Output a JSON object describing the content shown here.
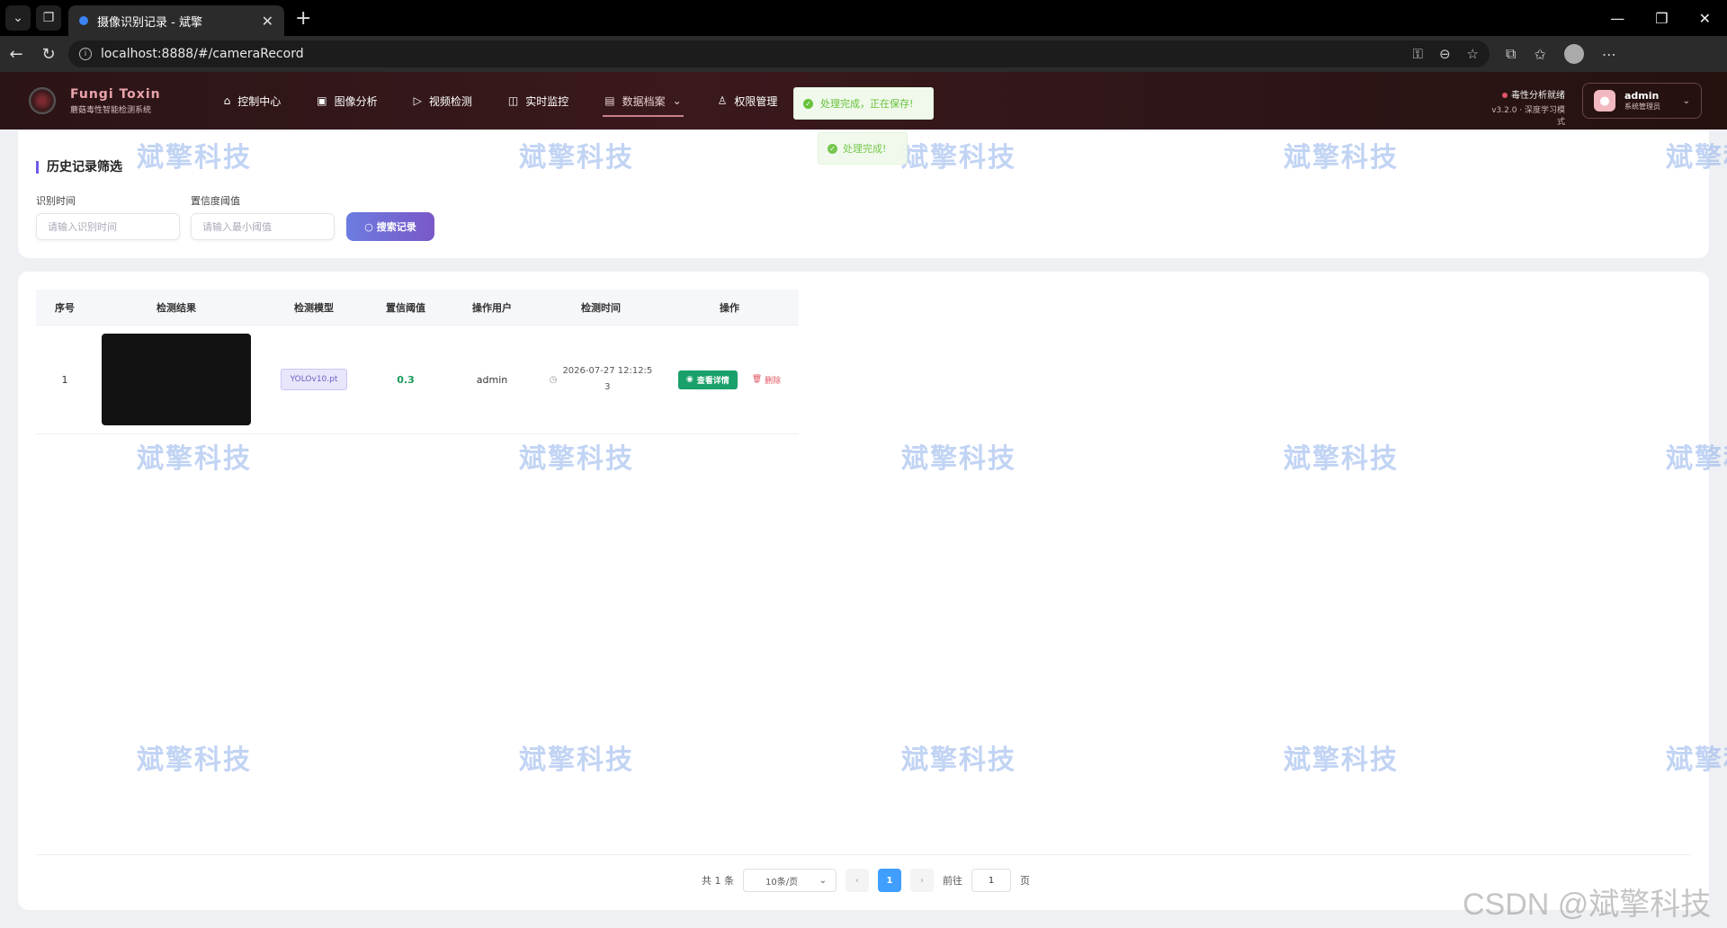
{
  "browser": {
    "tab_title": "摄像识别记录 - 斌擎",
    "url": "localhost:8888/#/cameraRecord",
    "url_host": "localhost",
    "url_rest": ":8888/#/cameraRecord"
  },
  "app": {
    "brand_name": "Fungi Toxin",
    "brand_sub": "蘑菇毒性智能检测系统",
    "menu": [
      {
        "label": "控制中心",
        "icon": "home-icon"
      },
      {
        "label": "图像分析",
        "icon": "image-icon"
      },
      {
        "label": "视频检测",
        "icon": "play-icon"
      },
      {
        "label": "实时监控",
        "icon": "camera-icon"
      },
      {
        "label": "数据档案",
        "icon": "document-icon",
        "active": true
      },
      {
        "label": "权限管理",
        "icon": "user-icon"
      }
    ],
    "status_text": "毒性分析就绪",
    "version_text": "v3.2.0 · 深度学习模式",
    "user_name": "admin",
    "user_role": "系统管理员"
  },
  "toasts": {
    "saving": "处理完成，正在保存!",
    "done": "处理完成!"
  },
  "filter": {
    "title": "历史记录筛选",
    "time_label": "识别时间",
    "time_placeholder": "请输入识别时间",
    "conf_label": "置信度阈值",
    "conf_placeholder": "请输入最小阈值",
    "search_label": "搜索记录"
  },
  "table": {
    "headers": [
      "序号",
      "检测结果",
      "检测模型",
      "置信阈值",
      "操作用户",
      "检测时间",
      "操作"
    ],
    "rows": [
      {
        "index": "1",
        "model": "YOLOv10.pt",
        "confidence": "0.3",
        "user": "admin",
        "time_line1": "2026-07-27 12:12:5",
        "time_line2": "3",
        "detail_label": "查看详情",
        "delete_label": "删除"
      }
    ]
  },
  "pagination": {
    "total_text": "共 1 条",
    "page_size": "10条/页",
    "current_page": "1",
    "goto_label": "前往",
    "goto_value": "1",
    "page_unit": "页"
  },
  "watermark": {
    "text": "斌擎科技",
    "csdn": "CSDN @斌擎科技"
  },
  "colors": {
    "header_bg": "#2b1416",
    "accent_purple": "#6c5ce7",
    "success_green": "#1aa06a",
    "danger_red": "#e05560",
    "pager_blue": "#409eff"
  }
}
